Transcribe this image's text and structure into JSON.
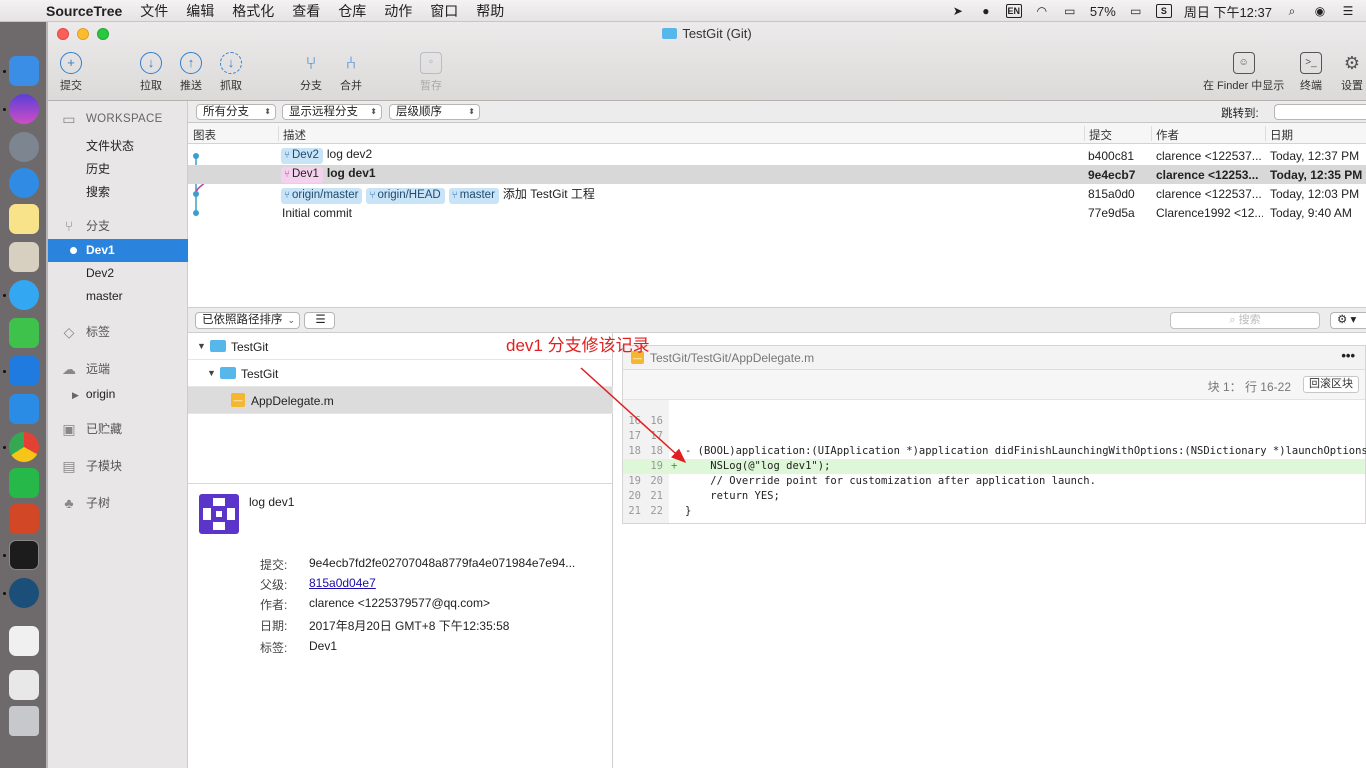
{
  "menubar": {
    "app_name": "SourceTree",
    "items": [
      "文件",
      "编辑",
      "格式化",
      "查看",
      "仓库",
      "动作",
      "窗口",
      "帮助"
    ],
    "ime": "EN",
    "battery": "57%",
    "clock": "周日 下午12:37"
  },
  "window": {
    "title": "TestGit (Git)"
  },
  "toolbar": {
    "commit": "提交",
    "pull": "拉取",
    "push": "推送",
    "fetch": "抓取",
    "branch": "分支",
    "merge": "合并",
    "stash": "暂存",
    "show_in_finder": "在 Finder 中显示",
    "terminal": "终端",
    "settings": "设置"
  },
  "sidebar": {
    "workspace": "WORKSPACE",
    "workspace_items": [
      "文件状态",
      "历史",
      "搜索"
    ],
    "branches_header": "分支",
    "branches": [
      "Dev1",
      "Dev2",
      "master"
    ],
    "tags_header": "标签",
    "remotes_header": "远端",
    "remote_origin": "origin",
    "stashes_header": "已贮藏",
    "submodules_header": "子模块",
    "subtrees_header": "子树"
  },
  "filters": {
    "branches": "所有分支",
    "remote": "显示远程分支",
    "order": "层级顺序",
    "jump_label": "跳转到:"
  },
  "table": {
    "headers": {
      "graph": "图表",
      "description": "描述",
      "commit": "提交",
      "author": "作者",
      "date": "日期"
    },
    "rows": [
      {
        "tags": [
          "Dev2"
        ],
        "message": "log dev2",
        "commit": "b400c81",
        "author": "clarence <122537...",
        "date": "Today, 12:37 PM"
      },
      {
        "tags": [
          "Dev1"
        ],
        "message": "log dev1",
        "commit": "9e4ecb7",
        "author": "clarence <12253...",
        "date": "Today, 12:35 PM"
      },
      {
        "tags": [
          "origin/master",
          "origin/HEAD",
          "master"
        ],
        "message": "添加 TestGit 工程",
        "commit": "815a0d0",
        "author": "clarence <122537...",
        "date": "Today, 12:03 PM"
      },
      {
        "tags": [],
        "message": "Initial commit",
        "commit": "77e9d5a",
        "author": "Clarence1992 <12...",
        "date": "Today, 9:40 AM"
      }
    ]
  },
  "files": {
    "sort_label": "已依照路径排序",
    "search_placeholder": "搜索",
    "tree": [
      "TestGit",
      "TestGit",
      "AppDelegate.m"
    ]
  },
  "details": {
    "subject": "log dev1",
    "commit_label": "提交:",
    "commit_value": "9e4ecb7fd2fe02707048a8779fa4e071984e7e94...",
    "parent_label": "父级:",
    "parent_value": "815a0d04e7",
    "author_label": "作者:",
    "author_value": "clarence <1225379577@qq.com>",
    "date_label": "日期:",
    "date_value": "2017年8月20日 GMT+8 下午12:35:58",
    "tags_label": "标签:",
    "tags_value": "Dev1"
  },
  "diff": {
    "file_path": "TestGit/TestGit/AppDelegate.m",
    "more": "•••",
    "hunk_label": "块 1： 行 16-22",
    "hunk_button": "回滚区块",
    "lines": [
      {
        "old": "16",
        "new": "16",
        "code": "",
        "added": false
      },
      {
        "old": "17",
        "new": "17",
        "code": "",
        "added": false
      },
      {
        "old": "18",
        "new": "18",
        "code": "- (BOOL)application:(UIApplication *)application didFinishLaunchingWithOptions:(NSDictionary *)launchOptions {",
        "added": false
      },
      {
        "old": "",
        "new": "19",
        "code": "    NSLog(@\"log dev1\");",
        "added": true
      },
      {
        "old": "19",
        "new": "20",
        "code": "    // Override point for customization after application launch.",
        "added": false
      },
      {
        "old": "20",
        "new": "21",
        "code": "    return YES;",
        "added": false
      },
      {
        "old": "21",
        "new": "22",
        "code": "}",
        "added": false
      }
    ]
  },
  "annotation": "dev1 分支修该记录",
  "colors": {
    "accent": "#2a84de",
    "dev1_tag": "#f4d2ee",
    "tag": "#c9e4f7",
    "annotation": "#e02020",
    "added_line": "#def7d8"
  }
}
